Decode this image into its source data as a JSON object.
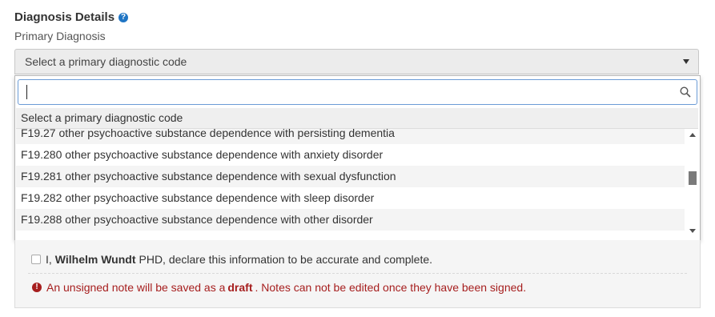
{
  "section": {
    "title": "Diagnosis Details",
    "help_icon": "question-circle-icon"
  },
  "field": {
    "label": "Primary Diagnosis"
  },
  "select": {
    "selected_value": "Select a primary diagnostic code",
    "arrow_icon": "caret-down-icon"
  },
  "dropdown": {
    "search_value": "",
    "search_icon": "magnifier-icon",
    "header_option": "Select a primary diagnostic code",
    "options": [
      {
        "label": "F19.27 other psychoactive substance dependence with persisting dementia"
      },
      {
        "label": "F19.280 other psychoactive substance dependence with anxiety disorder"
      },
      {
        "label": "F19.281 other psychoactive substance dependence with sexual dysfunction"
      },
      {
        "label": "F19.282 other psychoactive substance dependence with sleep disorder"
      },
      {
        "label": "F19.288 other psychoactive substance dependence with other disorder"
      }
    ]
  },
  "attestation": {
    "prefix": "I,",
    "name": "Wilhelm Wundt",
    "suffix": "PHD, declare this information to be accurate and complete."
  },
  "warning": {
    "icon": "exclamation-circle-icon",
    "text_before": "An unsigned note will be saved as a",
    "bold_word": "draft",
    "text_after": ". Notes can not be edited once they have been signed."
  },
  "colors": {
    "accent": "#1f75c4",
    "warning": "#a61e1e"
  }
}
